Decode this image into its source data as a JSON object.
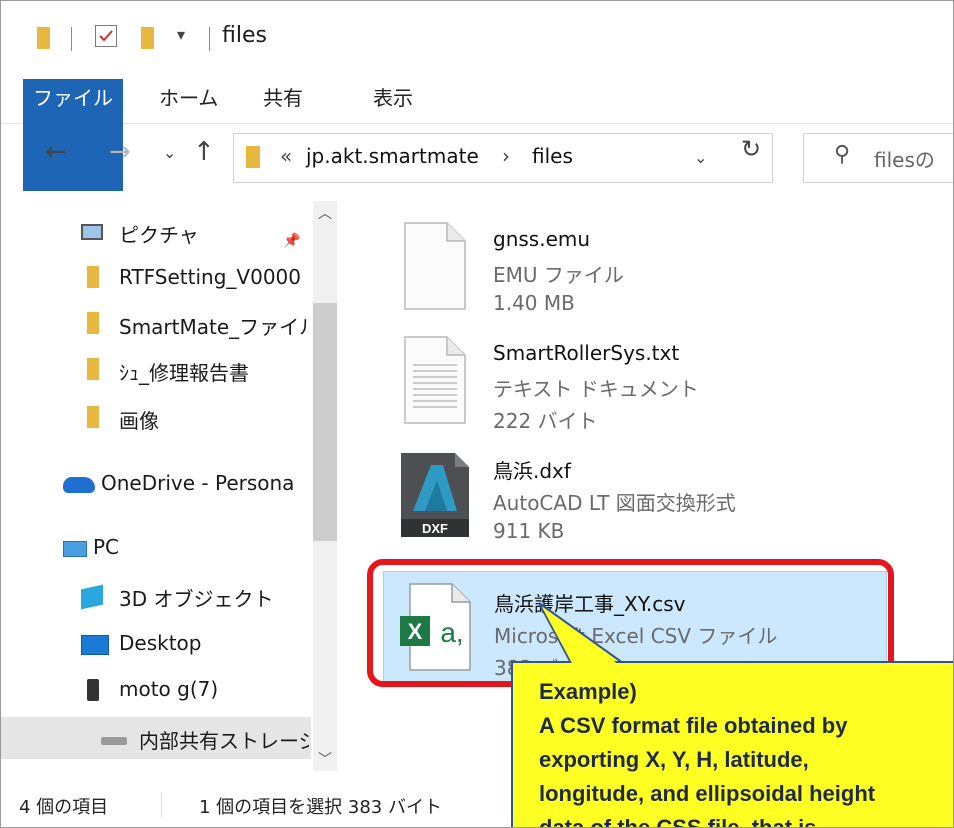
{
  "window": {
    "title": "files"
  },
  "ribbon": {
    "tabs": [
      "ファイル",
      "ホーム",
      "共有",
      "表示"
    ]
  },
  "address": {
    "overflow": "«",
    "segments": [
      "jp.akt.smartmate",
      "files"
    ],
    "separator": "›"
  },
  "search": {
    "placeholder": "filesの"
  },
  "nav_items": [
    {
      "label": "ピクチャ"
    },
    {
      "label": "RTFSetting_V0000"
    },
    {
      "label": "SmartMate_ファイル"
    },
    {
      "label": "ｼｭ_修理報告書"
    },
    {
      "label": "画像"
    },
    {
      "label": "OneDrive - Persona"
    },
    {
      "label": "PC"
    },
    {
      "label": "3D オブジェクト"
    },
    {
      "label": "Desktop"
    },
    {
      "label": "moto g(7)"
    },
    {
      "label": "内部共有ストレージ"
    }
  ],
  "files": [
    {
      "name": "gnss.emu",
      "type": "EMU ファイル",
      "size": "1.40 MB",
      "icon": "blank-file-icon"
    },
    {
      "name": "SmartRollerSys.txt",
      "type": "テキスト ドキュメント",
      "size": "222 バイト",
      "icon": "text-file-icon"
    },
    {
      "name": "鳥浜.dxf",
      "type": "AutoCAD LT 図面交換形式",
      "size": "911 KB",
      "icon": "autocad-dxf-icon",
      "badge": "DXF"
    },
    {
      "name": "鳥浜護岸工事_XY.csv",
      "type": "Microsoft Excel CSV ファイル",
      "size": "383 バイト",
      "icon": "excel-csv-icon",
      "selected": true
    }
  ],
  "status": {
    "count": "4 個の項目",
    "selection": "1 個の項目を選択 383 バイト"
  },
  "callout": {
    "lines": [
      "Example)",
      "A CSV format file obtained by",
      "exporting X, Y, H, latitude,",
      "longitude, and ellipsoidal height",
      "data of the CSS file, that is,"
    ]
  },
  "colors": {
    "file_tab": "#1f65b5",
    "selection": "#cce8ff",
    "highlight": "#e8141c",
    "callout_bg": "#ffff24",
    "folder": "#e8b73f"
  }
}
